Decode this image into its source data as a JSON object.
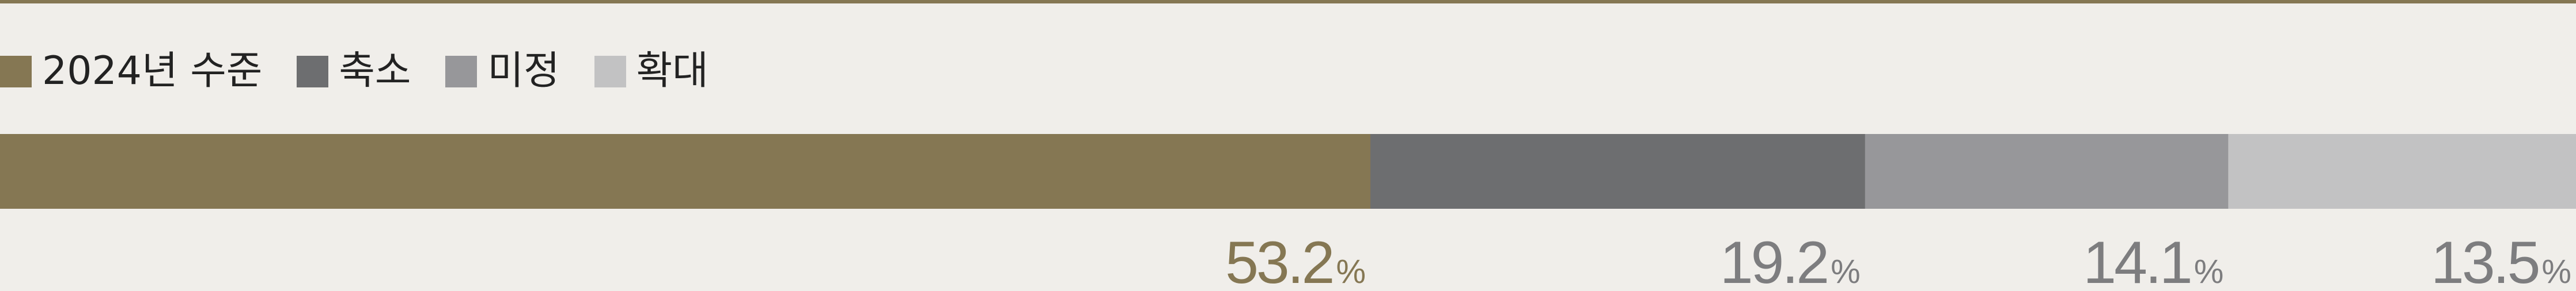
{
  "chart_data": {
    "type": "bar",
    "orientation": "horizontal",
    "stacked": true,
    "categories": [
      ""
    ],
    "series": [
      {
        "name": "2024년 수준",
        "values": [
          53.2
        ],
        "color": "#857753"
      },
      {
        "name": "축소",
        "values": [
          19.2
        ],
        "color": "#6d6e70"
      },
      {
        "name": "미정",
        "values": [
          14.1
        ],
        "color": "#97979a"
      },
      {
        "name": "확대",
        "values": [
          13.5
        ],
        "color": "#c2c2c3"
      }
    ],
    "data_labels": [
      "53.2",
      "19.2",
      "14.1",
      "13.5"
    ],
    "unit_label": "%",
    "label_color": "#7d7d7f",
    "first_label_color": "#857753",
    "legend_position": "top-left",
    "grid": false
  }
}
